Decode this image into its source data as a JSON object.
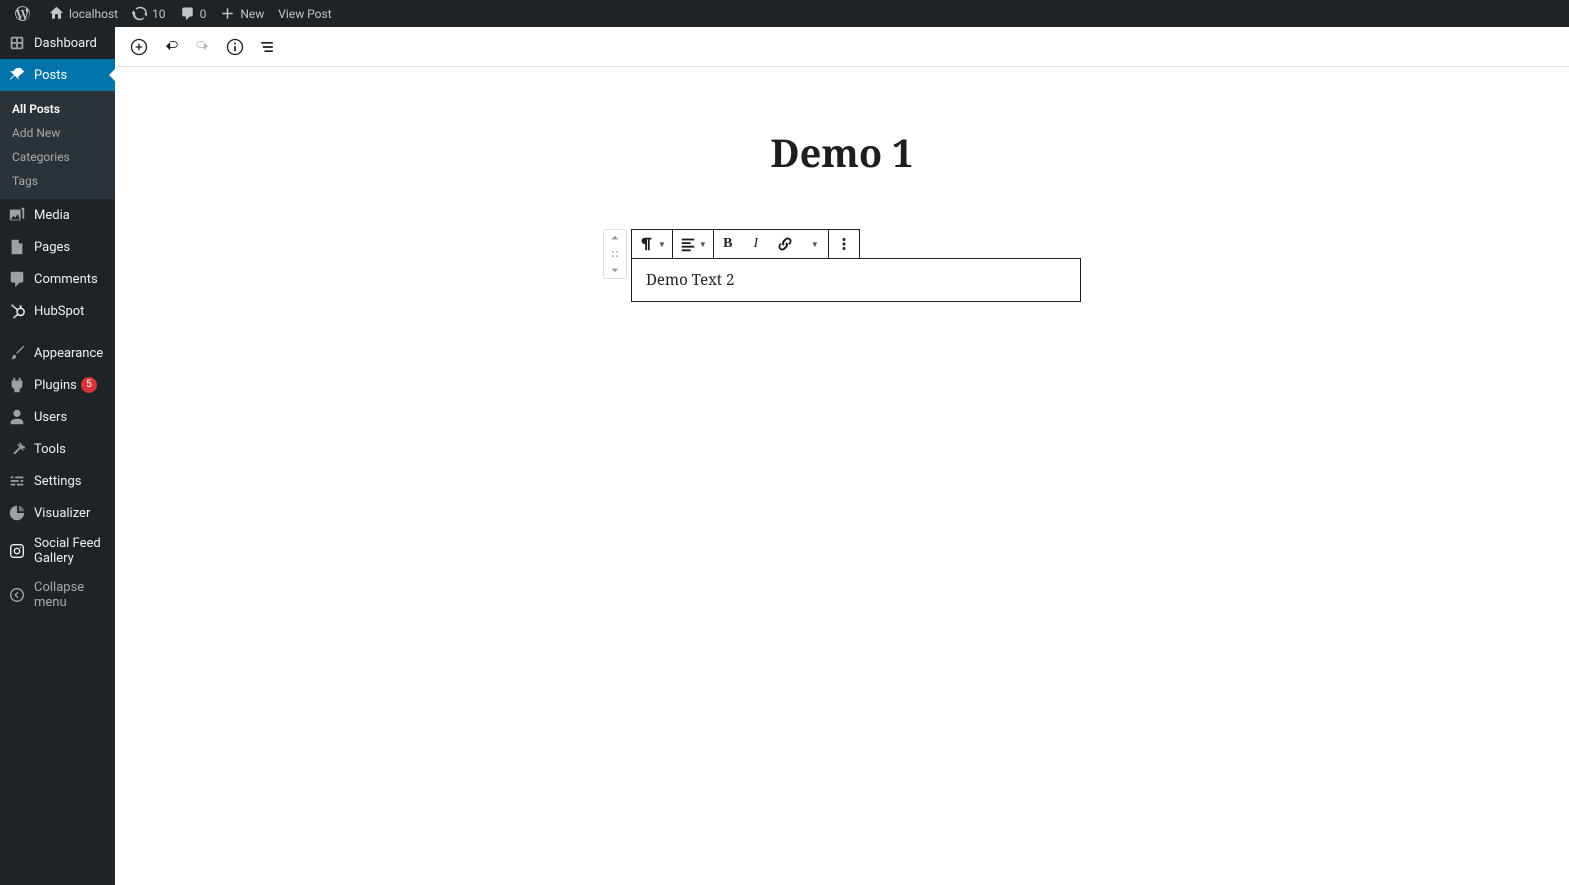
{
  "adminbar": {
    "site": "localhost",
    "updates": "10",
    "comments": "0",
    "new": "New",
    "view": "View Post"
  },
  "sidemenu": {
    "dashboard": "Dashboard",
    "posts": "Posts",
    "media": "Media",
    "pages": "Pages",
    "comments": "Comments",
    "hubspot": "HubSpot",
    "appearance": "Appearance",
    "plugins": "Plugins",
    "plugins_count": "5",
    "users": "Users",
    "tools": "Tools",
    "settings": "Settings",
    "visualizer": "Visualizer",
    "social_feed": "Social Feed Gallery",
    "collapse": "Collapse menu"
  },
  "posts_submenu": {
    "all": "All Posts",
    "add": "Add New",
    "categories": "Categories",
    "tags": "Tags"
  },
  "editor": {
    "title": "Demo 1",
    "block_text": "Demo Text 2"
  }
}
